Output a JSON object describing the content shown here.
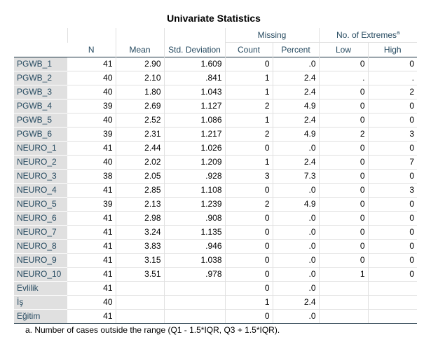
{
  "title": "Univariate Statistics",
  "headers": {
    "n": "N",
    "mean": "Mean",
    "std": "Std. Deviation",
    "missing": "Missing",
    "count": "Count",
    "percent": "Percent",
    "extremes": "No. of Extremes",
    "extremes_sup": "a",
    "low": "Low",
    "high": "High"
  },
  "rows": [
    {
      "label": "PGWB_1",
      "n": "41",
      "mean": "2.90",
      "std": "1.609",
      "count": "0",
      "percent": ".0",
      "low": "0",
      "high": "0"
    },
    {
      "label": "PGWB_2",
      "n": "40",
      "mean": "2.10",
      "std": ".841",
      "count": "1",
      "percent": "2.4",
      "low": ".",
      "high": "."
    },
    {
      "label": "PGWB_3",
      "n": "40",
      "mean": "1.80",
      "std": "1.043",
      "count": "1",
      "percent": "2.4",
      "low": "0",
      "high": "2"
    },
    {
      "label": "PGWB_4",
      "n": "39",
      "mean": "2.69",
      "std": "1.127",
      "count": "2",
      "percent": "4.9",
      "low": "0",
      "high": "0"
    },
    {
      "label": "PGWB_5",
      "n": "40",
      "mean": "2.52",
      "std": "1.086",
      "count": "1",
      "percent": "2.4",
      "low": "0",
      "high": "0"
    },
    {
      "label": "PGWB_6",
      "n": "39",
      "mean": "2.31",
      "std": "1.217",
      "count": "2",
      "percent": "4.9",
      "low": "2",
      "high": "3"
    },
    {
      "label": "NEURO_1",
      "n": "41",
      "mean": "2.44",
      "std": "1.026",
      "count": "0",
      "percent": ".0",
      "low": "0",
      "high": "0"
    },
    {
      "label": "NEURO_2",
      "n": "40",
      "mean": "2.02",
      "std": "1.209",
      "count": "1",
      "percent": "2.4",
      "low": "0",
      "high": "7"
    },
    {
      "label": "NEURO_3",
      "n": "38",
      "mean": "2.05",
      "std": ".928",
      "count": "3",
      "percent": "7.3",
      "low": "0",
      "high": "0"
    },
    {
      "label": "NEURO_4",
      "n": "41",
      "mean": "2.85",
      "std": "1.108",
      "count": "0",
      "percent": ".0",
      "low": "0",
      "high": "3"
    },
    {
      "label": "NEURO_5",
      "n": "39",
      "mean": "2.13",
      "std": "1.239",
      "count": "2",
      "percent": "4.9",
      "low": "0",
      "high": "0"
    },
    {
      "label": "NEURO_6",
      "n": "41",
      "mean": "2.98",
      "std": ".908",
      "count": "0",
      "percent": ".0",
      "low": "0",
      "high": "0"
    },
    {
      "label": "NEURO_7",
      "n": "41",
      "mean": "3.24",
      "std": "1.135",
      "count": "0",
      "percent": ".0",
      "low": "0",
      "high": "0"
    },
    {
      "label": "NEURO_8",
      "n": "41",
      "mean": "3.83",
      "std": ".946",
      "count": "0",
      "percent": ".0",
      "low": "0",
      "high": "0"
    },
    {
      "label": "NEURO_9",
      "n": "41",
      "mean": "3.15",
      "std": "1.038",
      "count": "0",
      "percent": ".0",
      "low": "0",
      "high": "0"
    },
    {
      "label": "NEURO_10",
      "n": "41",
      "mean": "3.51",
      "std": ".978",
      "count": "0",
      "percent": ".0",
      "low": "1",
      "high": "0"
    },
    {
      "label": "Evlilik",
      "n": "41",
      "mean": "",
      "std": "",
      "count": "0",
      "percent": ".0",
      "low": "",
      "high": ""
    },
    {
      "label": "İş",
      "n": "40",
      "mean": "",
      "std": "",
      "count": "1",
      "percent": "2.4",
      "low": "",
      "high": ""
    },
    {
      "label": "Eğitim",
      "n": "41",
      "mean": "",
      "std": "",
      "count": "0",
      "percent": ".0",
      "low": "",
      "high": ""
    }
  ],
  "footnote": "a. Number of cases outside the range (Q1 - 1.5*IQR, Q3 + 1.5*IQR)."
}
